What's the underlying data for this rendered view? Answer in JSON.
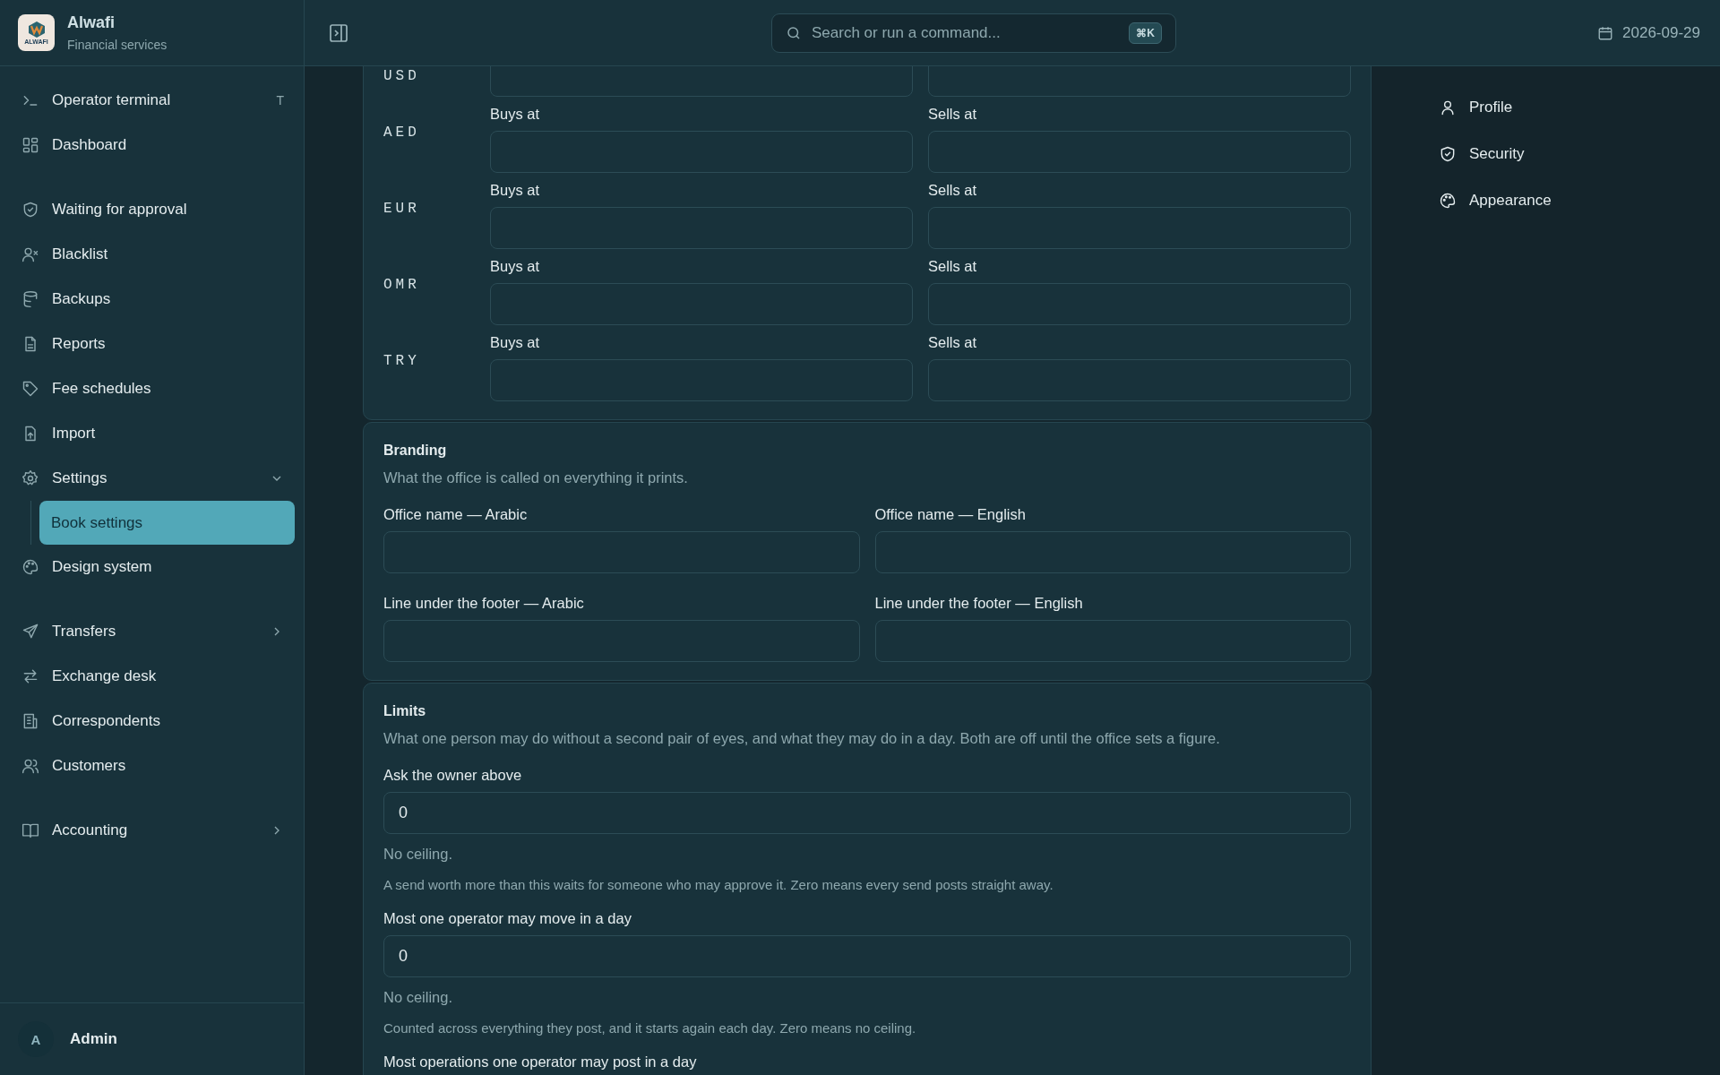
{
  "brand": {
    "name": "Alwafi",
    "subtitle": "Financial services",
    "logo_text": "ALWAFI"
  },
  "sidebar": {
    "groups": [
      {
        "items": [
          {
            "label": "Operator terminal",
            "shortcut": "T",
            "selected": false
          },
          {
            "label": "Dashboard",
            "selected": false
          }
        ]
      },
      {
        "items": [
          {
            "label": "Waiting for approval",
            "selected": false
          },
          {
            "label": "Blacklist",
            "selected": false
          },
          {
            "label": "Backups",
            "selected": false
          },
          {
            "label": "Reports",
            "selected": false
          },
          {
            "label": "Fee schedules",
            "selected": false
          },
          {
            "label": "Import",
            "selected": false
          },
          {
            "label": "Settings",
            "selected": false,
            "expanded": true,
            "children": [
              {
                "label": "Book settings",
                "selected": true
              }
            ]
          },
          {
            "label": "Design system",
            "selected": false
          }
        ]
      },
      {
        "items": [
          {
            "label": "Transfers",
            "selected": false,
            "expanded": false
          },
          {
            "label": "Exchange desk",
            "selected": false
          },
          {
            "label": "Correspondents",
            "selected": false
          },
          {
            "label": "Customers",
            "selected": false
          }
        ]
      },
      {
        "items": [
          {
            "label": "Accounting",
            "selected": false,
            "expanded": false
          }
        ]
      }
    ],
    "user": {
      "initial": "A",
      "name": "Admin"
    }
  },
  "header": {
    "search_placeholder": "Search or run a command...",
    "shortcut": "⌘K",
    "date": "2026-09-29"
  },
  "rates": [
    {
      "currency": "USD"
    },
    {
      "currency": "AED",
      "buys_label": "Buys at",
      "sells_label": "Sells at"
    },
    {
      "currency": "EUR",
      "buys_label": "Buys at",
      "sells_label": "Sells at"
    },
    {
      "currency": "OMR",
      "buys_label": "Buys at",
      "sells_label": "Sells at"
    },
    {
      "currency": "TRY",
      "buys_label": "Buys at",
      "sells_label": "Sells at"
    }
  ],
  "branding": {
    "title": "Branding",
    "description": "What the office is called on everything it prints.",
    "fields": [
      {
        "label": "Office name — Arabic"
      },
      {
        "label": "Office name — English"
      },
      {
        "label": "Line under the footer — Arabic"
      },
      {
        "label": "Line under the footer — English"
      }
    ]
  },
  "limits": {
    "title": "Limits",
    "description": "What one person may do without a second pair of eyes, and what they may do in a day. Both are off until the office sets a figure.",
    "fields": [
      {
        "label": "Ask the owner above",
        "value": "0",
        "note": "No ceiling.",
        "help": "A send worth more than this waits for someone who may approve it. Zero means every send posts straight away."
      },
      {
        "label": "Most one operator may move in a day",
        "value": "0",
        "note": "No ceiling.",
        "help": "Counted across everything they post, and it starts again each day. Zero means no ceiling."
      },
      {
        "label": "Most operations one operator may post in a day"
      }
    ]
  },
  "settings_nav": [
    {
      "label": "Profile",
      "selected": false
    },
    {
      "label": "Security",
      "selected": false
    },
    {
      "label": "Appearance",
      "selected": false
    }
  ]
}
